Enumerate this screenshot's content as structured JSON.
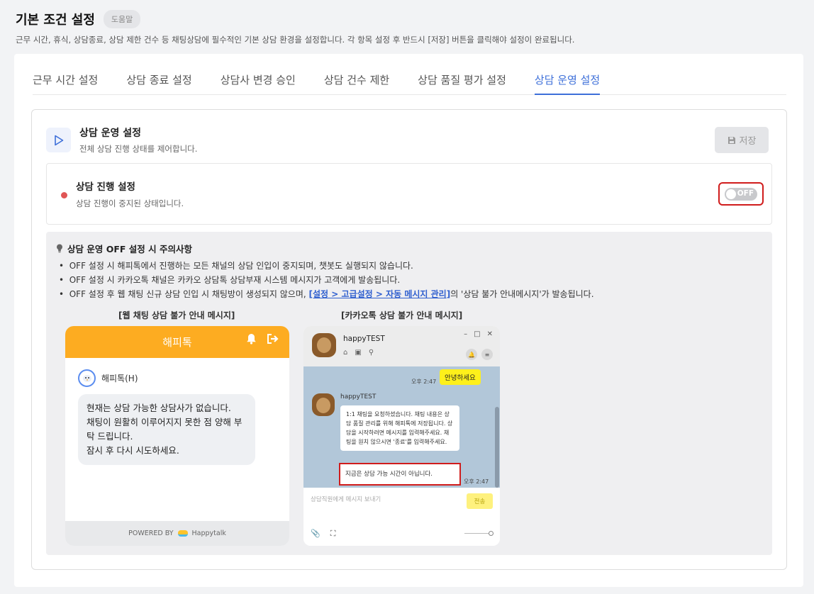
{
  "page": {
    "title": "기본 조건 설정",
    "help_label": "도움말",
    "description": "근무 시간, 휴식, 상담종료, 상담 제한 건수 등 채팅상담에 필수적인 기본 상담 환경을 설정합니다. 각 항목 설정 후 반드시 [저장] 버튼을 클릭해야 설정이 완료됩니다."
  },
  "tabs": [
    {
      "label": "근무 시간 설정",
      "active": false
    },
    {
      "label": "상담 종료 설정",
      "active": false
    },
    {
      "label": "상담사 변경 승인",
      "active": false
    },
    {
      "label": "상담 건수 제한",
      "active": false
    },
    {
      "label": "상담 품질 평가 설정",
      "active": false
    },
    {
      "label": "상담 운영 설정",
      "active": true
    }
  ],
  "section": {
    "icon": "play-icon",
    "title": "상담 운영 설정",
    "description": "전체 상담 진행 상태를 제어합니다.",
    "save_label": "저장"
  },
  "status": {
    "title": "상담 진행 설정",
    "description": "상담 진행이 중지된 상태입니다.",
    "toggle_label": "OFF",
    "dot_color": "#e05555"
  },
  "warning": {
    "title": "상담 운영 OFF 설정 시 주의사항",
    "items": [
      "OFF 설정 시 해피톡에서 진행하는 모든 채널의 상담 인입이 중지되며, 챗봇도 실행되지 않습니다.",
      "OFF 설정 시 카카오톡 채널은 카카오 상담톡 상담부재 시스템 메시지가 고객에게 발송됩니다."
    ],
    "item3_prefix": "OFF 설정 후 웹 채팅 신규 상담 인입 시 채팅방이 생성되지 않으며, ",
    "item3_link": "[설정 > 고급설정 > 자동 메시지 관리]",
    "item3_suffix": "의 '상담 불가 안내메시지'가 발송됩니다."
  },
  "web_preview": {
    "caption": "[웹 채팅 상담 불가 안내 메시지]",
    "header_title": "해피톡",
    "bot_name": "해피톡(H)",
    "message_lines": [
      "현재는 상담 가능한 상담사가 없습니다.",
      "채팅이 원활히 이루어지지 못한 점 양해 부탁 드립니다.",
      "잠시 후 다시 시도하세요."
    ],
    "footer_prefix": "POWERED BY",
    "footer_brand": "Happytalk"
  },
  "kakao_preview": {
    "caption": "[카카오톡 상담 불가 안내 메시지]",
    "name": "happyTEST",
    "my_time": "오후 2:47",
    "my_message": "안녕하세요",
    "sender_name": "happyTEST",
    "bot_message": "1:1 채팅을 요청하셨습니다. 채팅 내용은 상담 품질 관리를 위해 해피톡에 저장됩니다. 상담을 시작하려면 메시지를 입력해주세요. 채팅을 원치 않으시면 '종료'를 입력해주세요.",
    "alert_message": "지금은 상담 가능 시간이 아닙니다.",
    "alert_time": "오후 2:47",
    "input_placeholder": "상담직원에게 메시지 보내기",
    "send_label": "전송"
  }
}
